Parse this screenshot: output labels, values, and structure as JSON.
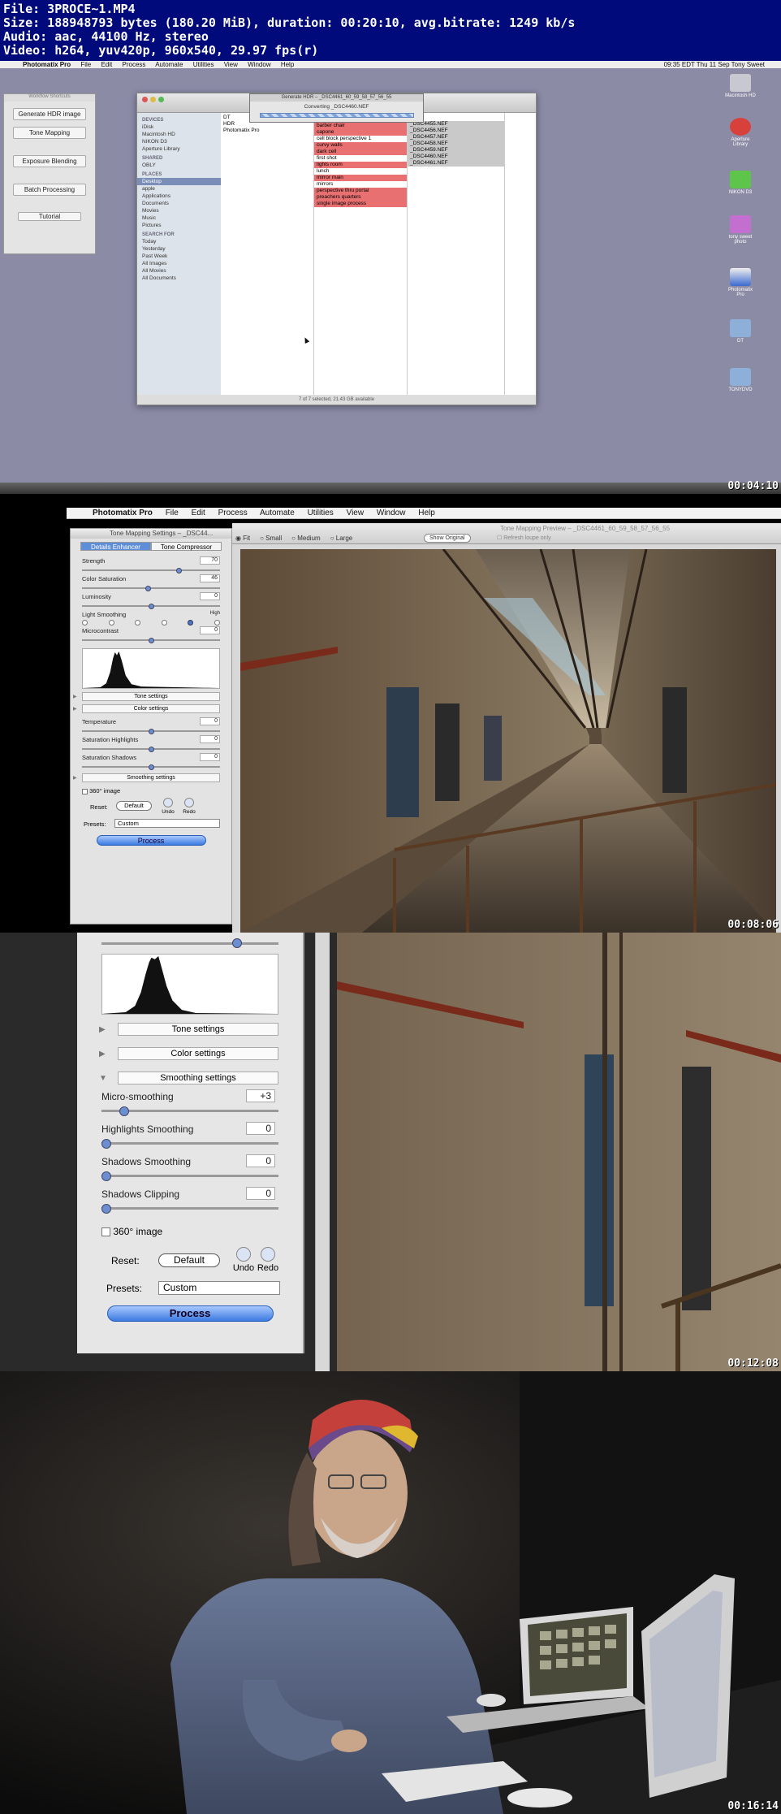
{
  "header": {
    "file": "File: 3PROCE~1.MP4",
    "size": "Size: 188948793 bytes (180.20 MiB), duration: 00:20:10, avg.bitrate: 1249 kb/s",
    "audio": "Audio: aac, 44100 Hz, stereo",
    "video": "Video: h264, yuv420p, 960x540, 29.97 fps(r)"
  },
  "frame1": {
    "timecode": "00:04:10",
    "menubar": [
      "Photomatix Pro",
      "File",
      "Edit",
      "Process",
      "Automate",
      "Utilities",
      "View",
      "Window",
      "Help"
    ],
    "clock": "09:35 EDT Thu 11 Sep   Tony Sweet",
    "workflow_title": "Workflow Shortcuts",
    "workflow_buttons": [
      "Generate HDR image",
      "Tone Mapping",
      "Exposure Blending",
      "Batch Processing",
      "Tutorial"
    ],
    "progress_title": "Generate HDR – _DSC4461_60_59_58_57_56_55",
    "progress_text": "Converting _DSC4460.NEF",
    "sidebar": {
      "devices_header": "DEVICES",
      "devices": [
        "iDisk",
        "Macintosh HD",
        "NIKON D3",
        "Aperture Library"
      ],
      "shared_header": "SHARED",
      "shared": [
        "OBLY"
      ],
      "places_header": "PLACES",
      "places": [
        "Desktop",
        "apple",
        "Applications",
        "Documents",
        "Movies",
        "Music",
        "Pictures"
      ],
      "search_header": "SEARCH FOR",
      "search": [
        "Today",
        "Yesterday",
        "Past Week",
        "All Images",
        "All Movies",
        "All Documents"
      ]
    },
    "col1": [
      "DT",
      "HDR",
      "Photomatix Pro"
    ],
    "col2": [
      "barber chair",
      "capone",
      "cell block perspective 1",
      "curvy walls",
      "dark cell",
      "first shot",
      "lights room",
      "lunch",
      "mirror main",
      "mirrors",
      "perspective thru portal",
      "preachers quarters",
      "single image process"
    ],
    "col3": [
      "_DSC4455.NEF",
      "_DSC4456.NEF",
      "_DSC4457.NEF",
      "_DSC4458.NEF",
      "_DSC4459.NEF",
      "_DSC4460.NEF",
      "_DSC4461.NEF"
    ],
    "status": "7 of 7 selected, 21.43 GB available",
    "desktop_icons": [
      "Macintosh HD",
      "Aperture Library",
      "NIKON D3",
      "tony sweet photo",
      "Photomatix Pro",
      "DT",
      "TONYDVD"
    ]
  },
  "frame2": {
    "timecode": "00:08:06",
    "menubar": [
      "Photomatix Pro",
      "File",
      "Edit",
      "Process",
      "Automate",
      "Utilities",
      "View",
      "Window",
      "Help"
    ],
    "panel_title": "Tone Mapping Settings – _DSC44...",
    "tabs": [
      "Details Enhancer",
      "Tone Compressor"
    ],
    "sliders": [
      {
        "label": "Strength",
        "value": "70",
        "pos": 0.7
      },
      {
        "label": "Color Saturation",
        "value": "46",
        "pos": 0.46
      },
      {
        "label": "Luminosity",
        "value": "0",
        "pos": 0.5
      },
      {
        "label": "Microcontrast",
        "value": "0",
        "pos": 0.5
      }
    ],
    "light_smoothing": "Light Smoothing",
    "high": "High",
    "sections": [
      "Tone settings",
      "Color settings",
      "Smoothing settings"
    ],
    "color_sliders": [
      {
        "label": "Temperature",
        "value": "0",
        "pos": 0.5
      },
      {
        "label": "Saturation Highlights",
        "value": "0",
        "pos": 0.5
      },
      {
        "label": "Saturation Shadows",
        "value": "0",
        "pos": 0.5
      }
    ],
    "image360": "360° image",
    "reset_label": "Reset:",
    "default_btn": "Default",
    "undo": "Undo",
    "redo": "Redo",
    "presets_label": "Presets:",
    "presets_value": "Custom",
    "process": "Process",
    "preview_title": "Tone Mapping Preview – _DSC4461_60_59_58_57_56_55",
    "zoom_options": [
      "Fit",
      "Small",
      "Medium",
      "Large"
    ],
    "show_original": "Show Original",
    "refresh": "Refresh loupe only"
  },
  "frame3": {
    "timecode": "00:12:08",
    "sections": [
      "Tone settings",
      "Color settings",
      "Smoothing settings"
    ],
    "sliders": [
      {
        "label": "Micro-smoothing",
        "value": "+3",
        "pos": 0.12
      },
      {
        "label": "Highlights Smoothing",
        "value": "0",
        "pos": 0.03
      },
      {
        "label": "Shadows Smoothing",
        "value": "0",
        "pos": 0.03
      },
      {
        "label": "Shadows Clipping",
        "value": "0",
        "pos": 0.03
      }
    ],
    "image360": "360° image",
    "reset_label": "Reset:",
    "default_btn": "Default",
    "undo": "Undo",
    "redo": "Redo",
    "presets_label": "Presets:",
    "presets_value": "Custom",
    "process": "Process"
  },
  "frame4": {
    "timecode": "00:16:14"
  }
}
